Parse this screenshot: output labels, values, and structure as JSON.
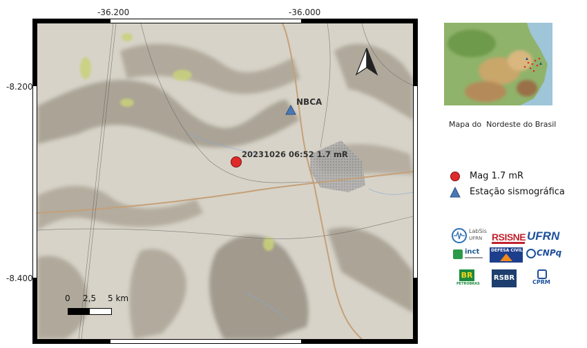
{
  "axes": {
    "x_ticks": [
      "-36.200",
      "-36.000"
    ],
    "y_ticks": [
      "-8.200",
      "-8.400"
    ]
  },
  "event": {
    "label": "20231026 06:52 1.7 mR",
    "color": "#e02a2a"
  },
  "station": {
    "label": "NBCA",
    "color": "#4a78b4"
  },
  "north_arrow": {
    "icon": "north-arrow-icon"
  },
  "scale_bar": {
    "ticks": [
      "0",
      "2,5",
      "5 km"
    ]
  },
  "inset": {
    "caption": "Mapa do  Nordeste do Brasil"
  },
  "legend": {
    "items": [
      {
        "label": "Mag 1.7 mR",
        "symbol": "red-circle",
        "color": "#e02a2a"
      },
      {
        "label": "Estação sismográfica",
        "symbol": "blue-triangle",
        "color": "#4a78b4"
      }
    ]
  },
  "logos": {
    "labsis": "LabSis",
    "labsis_sub": "UFRN",
    "rsisne": "RSISNE",
    "ufrn": "UFRN",
    "defesa": "DEFESA CIVIL",
    "inct": "inct",
    "cnpq": "CNPq",
    "br": "BR",
    "petrobras": "PETROBRAS",
    "rsbr": "RSBR",
    "cprm": "CPRM"
  },
  "colors": {
    "terrain": "#d6d2c6",
    "relief_dark": "#8f877a",
    "vegetation": "#c8d27a",
    "road": "#c9a37a",
    "town": "#9c9c9c",
    "water": "#8aa9d8"
  }
}
